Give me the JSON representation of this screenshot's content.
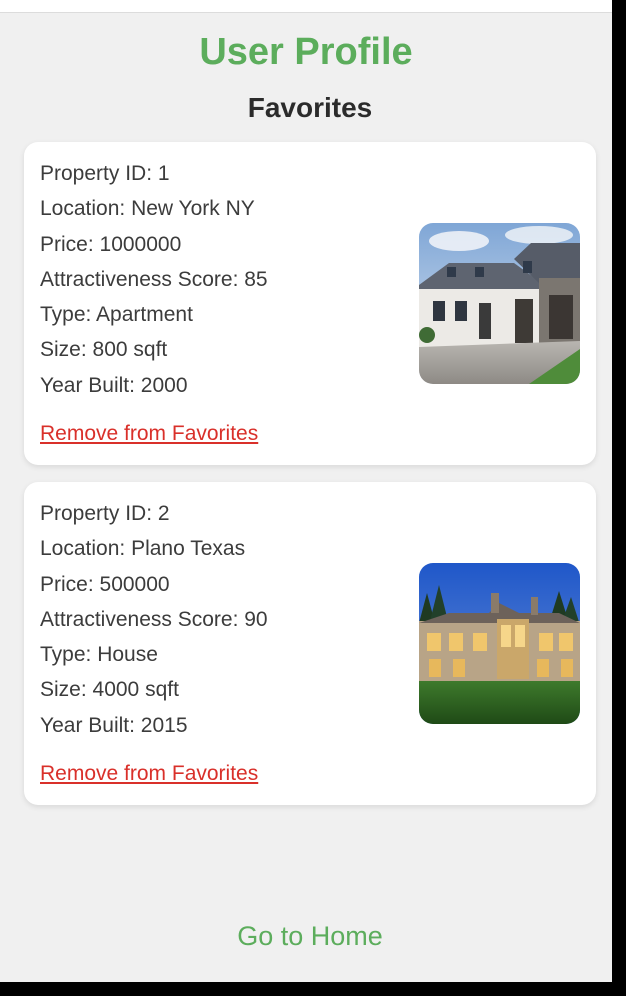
{
  "colors": {
    "accent_green": "#5cad5c",
    "link_red": "#d9302a",
    "background": "#f0f0f0",
    "card": "#ffffff"
  },
  "header": {
    "title": "User Profile"
  },
  "favorites": {
    "heading": "Favorites",
    "remove_label": "Remove from Favorites",
    "properties": [
      {
        "id_line": "Property ID: 1",
        "location_line": "Location: New York NY",
        "price_line": "Price: 1000000",
        "score_line": "Attractiveness Score: 85",
        "type_line": "Type: Apartment",
        "size_line": "Size: 800 sqft",
        "year_line": "Year Built: 2000",
        "image": "white-suburban-house-photo"
      },
      {
        "id_line": "Property ID: 2",
        "location_line": "Location: Plano Texas",
        "price_line": "Price: 500000",
        "score_line": "Attractiveness Score: 90",
        "type_line": "Type: House",
        "size_line": "Size: 4000 sqft",
        "year_line": "Year Built: 2015",
        "image": "stone-mansion-dusk-photo"
      }
    ]
  },
  "footer": {
    "home_link": "Go to Home"
  }
}
